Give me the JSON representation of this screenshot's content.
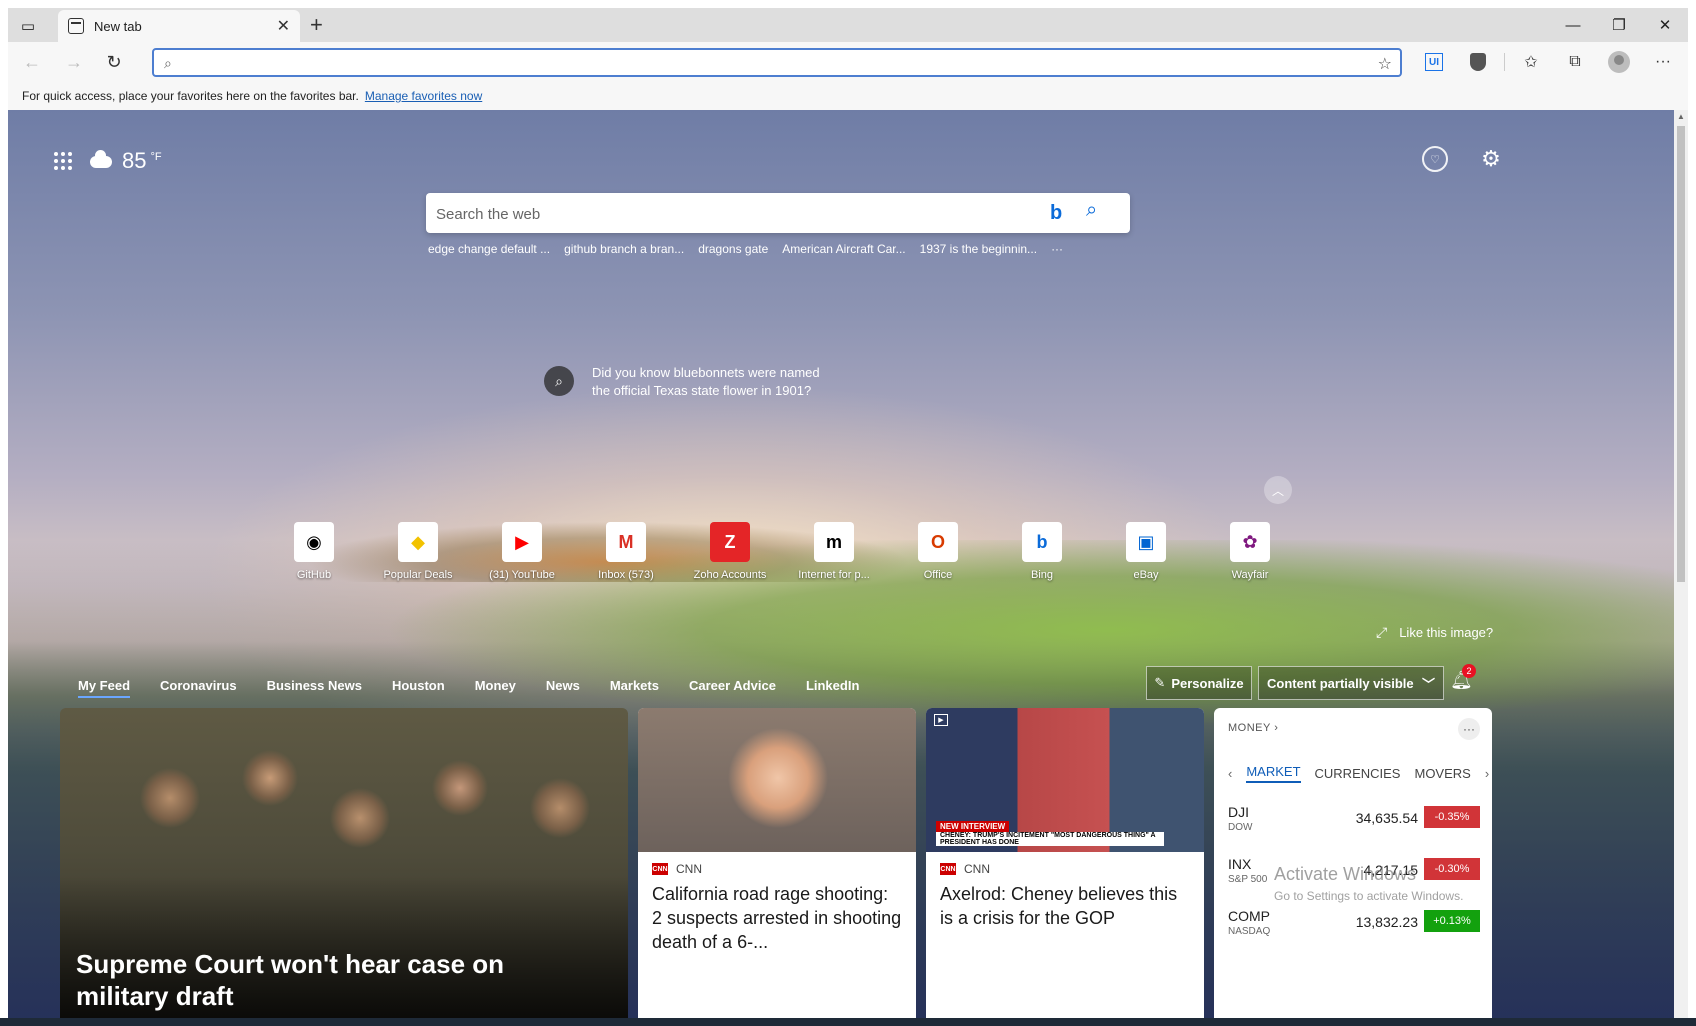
{
  "tab": {
    "title": "New tab"
  },
  "addressbar": {
    "value": "",
    "placeholder": ""
  },
  "favorites_bar": {
    "text": "For quick access, place your favorites here on the favorites bar.",
    "link": "Manage favorites now"
  },
  "extensions": {
    "ui_badge": "UI"
  },
  "weather": {
    "temperature": "85",
    "unit": "°F"
  },
  "search": {
    "placeholder": "Search the web",
    "suggestions": [
      "edge change default ...",
      "github branch a bran...",
      "dragons gate",
      "American Aircraft Car...",
      "1937 is the beginnin...",
      "···"
    ]
  },
  "did_you_know": {
    "text": "Did you know bluebonnets were named the official Texas state flower in 1901?"
  },
  "quick_links": [
    {
      "label": "GitHub",
      "glyph": "◉",
      "color": "#000000"
    },
    {
      "label": "Popular Deals",
      "glyph": "◆",
      "color": "#f2c200"
    },
    {
      "label": "(31) YouTube",
      "glyph": "▶",
      "color": "#ff0000"
    },
    {
      "label": "Inbox (573)",
      "glyph": "M",
      "color": "#d93025"
    },
    {
      "label": "Zoho Accounts",
      "glyph": "Z",
      "color": "#e42527"
    },
    {
      "label": "Internet for p...",
      "glyph": "m",
      "color": "#000000"
    },
    {
      "label": "Office",
      "glyph": "O",
      "color": "#d83b01"
    },
    {
      "label": "Bing",
      "glyph": "b",
      "color": "#0b6bd9"
    },
    {
      "label": "eBay",
      "glyph": "▣",
      "color": "#0064d2"
    },
    {
      "label": "Wayfair",
      "glyph": "✿",
      "color": "#7f187f"
    }
  ],
  "like_image": "Like this image?",
  "feed_nav": [
    "My Feed",
    "Coronavirus",
    "Business News",
    "Houston",
    "Money",
    "News",
    "Markets",
    "Career Advice",
    "LinkedIn"
  ],
  "personalize": "Personalize",
  "content_visibility": "Content partially visible",
  "notifications": {
    "count": "2"
  },
  "hero": {
    "title": "Supreme Court won't hear case on military draft"
  },
  "cards": [
    {
      "source": "CNN",
      "headline": "California road rage shooting: 2 suspects arrested in shooting death of a 6-..."
    },
    {
      "source": "CNN",
      "headline": "Axelrod: Cheney believes this is a crisis for the GOP",
      "video_tag": "NEW INTERVIEW",
      "banner": "CHENEY: TRUMP'S INCITEMENT \"MOST DANGEROUS THING\" A PRESIDENT HAS DONE"
    }
  ],
  "money": {
    "header": "MONEY",
    "tabs": [
      "MARKET",
      "CURRENCIES",
      "MOVERS"
    ],
    "rows": [
      {
        "symbol": "DJI",
        "name": "DOW",
        "price": "34,635.54",
        "change": "-0.35%",
        "direction": "down"
      },
      {
        "symbol": "INX",
        "name": "S&P 500",
        "price": "4,217.15",
        "change": "-0.30%",
        "direction": "down"
      },
      {
        "symbol": "COMP",
        "name": "NASDAQ",
        "price": "13,832.23",
        "change": "+0.13%",
        "direction": "up"
      }
    ]
  },
  "watermark": {
    "line1": "Activate Windows",
    "line2": "Go to Settings to activate Windows."
  }
}
